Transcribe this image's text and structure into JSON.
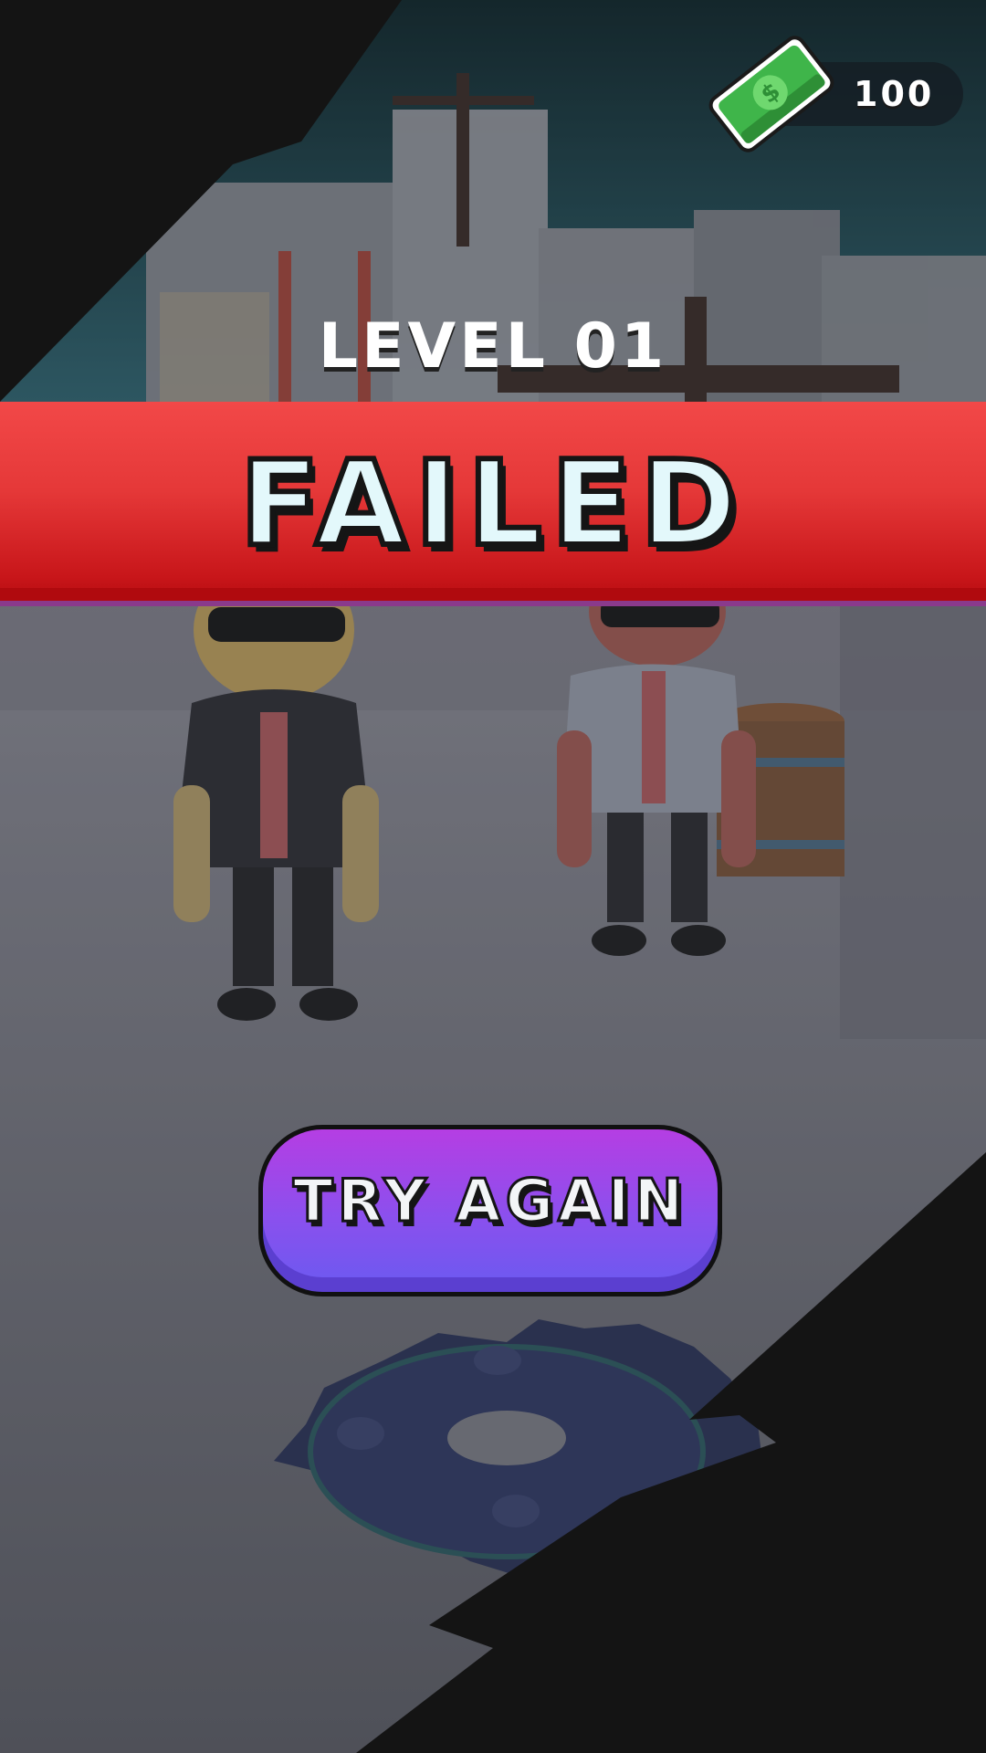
{
  "hud": {
    "currency_icon": "cash-bill-icon",
    "currency_amount": "100"
  },
  "level": {
    "title": "LEVEL 01",
    "result": "FAILED"
  },
  "actions": {
    "try_again_label": "TRY AGAIN"
  },
  "scene": {
    "characters": [
      "enemy-black-suit",
      "enemy-white-suit"
    ],
    "hazard": "saw-blade-icon"
  },
  "colors": {
    "banner_red": "#e53838",
    "button_purple": "#8a50ee",
    "cash_green": "#3fb54a",
    "title_text": "#e3f8fb"
  }
}
